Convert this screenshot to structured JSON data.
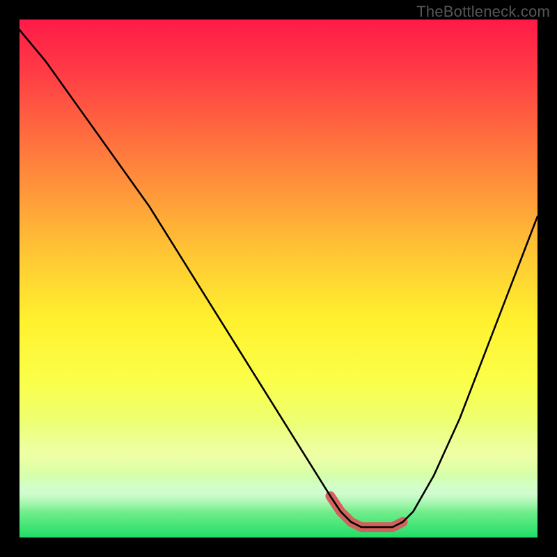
{
  "watermark": "TheBottleneck.com",
  "chart_data": {
    "type": "line",
    "title": "",
    "xlabel": "",
    "ylabel": "",
    "xlim": [
      0,
      100
    ],
    "ylim": [
      0,
      100
    ],
    "grid": false,
    "legend": false,
    "series": [
      {
        "name": "bottleneck-curve",
        "x": [
          0,
          5,
          10,
          15,
          20,
          25,
          30,
          35,
          40,
          45,
          50,
          55,
          60,
          62,
          64,
          66,
          68,
          70,
          72,
          74,
          76,
          80,
          85,
          90,
          95,
          100
        ],
        "values": [
          98,
          92,
          85,
          78,
          71,
          64,
          56,
          48,
          40,
          32,
          24,
          16,
          8,
          5,
          3,
          2,
          2,
          2,
          2,
          3,
          5,
          12,
          23,
          36,
          49,
          62
        ]
      }
    ],
    "highlight_range": {
      "x_start": 60,
      "x_end": 74
    },
    "annotations": []
  }
}
